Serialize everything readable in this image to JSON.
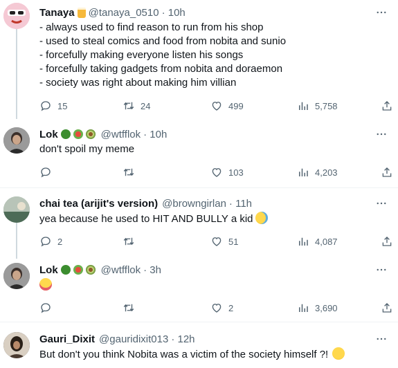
{
  "tweets": [
    {
      "name": "Tanaya",
      "handle": "@tanaya_0510",
      "time": "· 10h",
      "lines": [
        "- always used to find reason to run from his shop",
        "- used to steal comics and food from nobita and sunio",
        "- forcefully making everyone listen his songs",
        "- forcefully taking gadgets from nobita and doraemon",
        "- society was right about making him villian"
      ],
      "replies": "15",
      "retweets": "24",
      "likes": "499",
      "views": "5,758"
    },
    {
      "name": "Lok",
      "handle": "@wtfflok",
      "time": "· 10h",
      "lines": [
        "don't spoil my meme"
      ],
      "replies": "",
      "retweets": "",
      "likes": "103",
      "views": "4,203"
    },
    {
      "name": "chai tea (arijit's version)",
      "handle": "@browngirlan",
      "time": "· 11h",
      "lines": [
        "yea because he used to HIT AND BULLY a kid"
      ],
      "replies": "2",
      "retweets": "",
      "likes": "51",
      "views": "4,087"
    },
    {
      "name": "Lok",
      "handle": "@wtfflok",
      "time": "· 3h",
      "lines": [
        ""
      ],
      "replies": "",
      "retweets": "",
      "likes": "2",
      "views": "3,690"
    },
    {
      "name": "Gauri_Dixit",
      "handle": "@gauridixit013",
      "time": "· 12h",
      "lines": [
        "But don't you think Nobita was a victim of the society himself ?!"
      ],
      "replies": "",
      "retweets": "",
      "likes": "",
      "views": ""
    }
  ],
  "icons": {
    "reply": "reply-icon",
    "retweet": "retweet-icon",
    "like": "heart-icon",
    "views": "views-icon",
    "share": "share-icon",
    "more": "more-icon"
  },
  "colors": {
    "text": "#0f1419",
    "muted": "#536471",
    "border": "#eff3f4"
  }
}
